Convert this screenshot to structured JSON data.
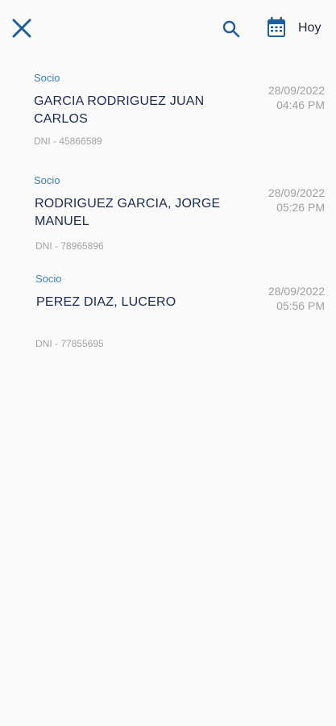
{
  "header": {
    "close_icon": "close-icon",
    "search_icon": "search-icon",
    "calendar_icon": "calendar-icon",
    "today_label": "Hoy",
    "accent_color": "#1e5f99"
  },
  "records": [
    {
      "type": "Socio",
      "name": "GARCIA RODRIGUEZ JUAN CARLOS",
      "dni": "DNI - 45866589",
      "date": "28/09/2022",
      "time": "04:46 PM"
    },
    {
      "type": "Socio",
      "name": "RODRIGUEZ GARCIA, JORGE MANUEL",
      "dni": "DNI - 78965896",
      "date": "28/09/2022",
      "time": "05:26 PM"
    },
    {
      "type": "Socio",
      "name": "PEREZ DIAZ, LUCERO",
      "dni": "DNI - 77855695",
      "date": "28/09/2022",
      "time": "05:56 PM"
    }
  ]
}
